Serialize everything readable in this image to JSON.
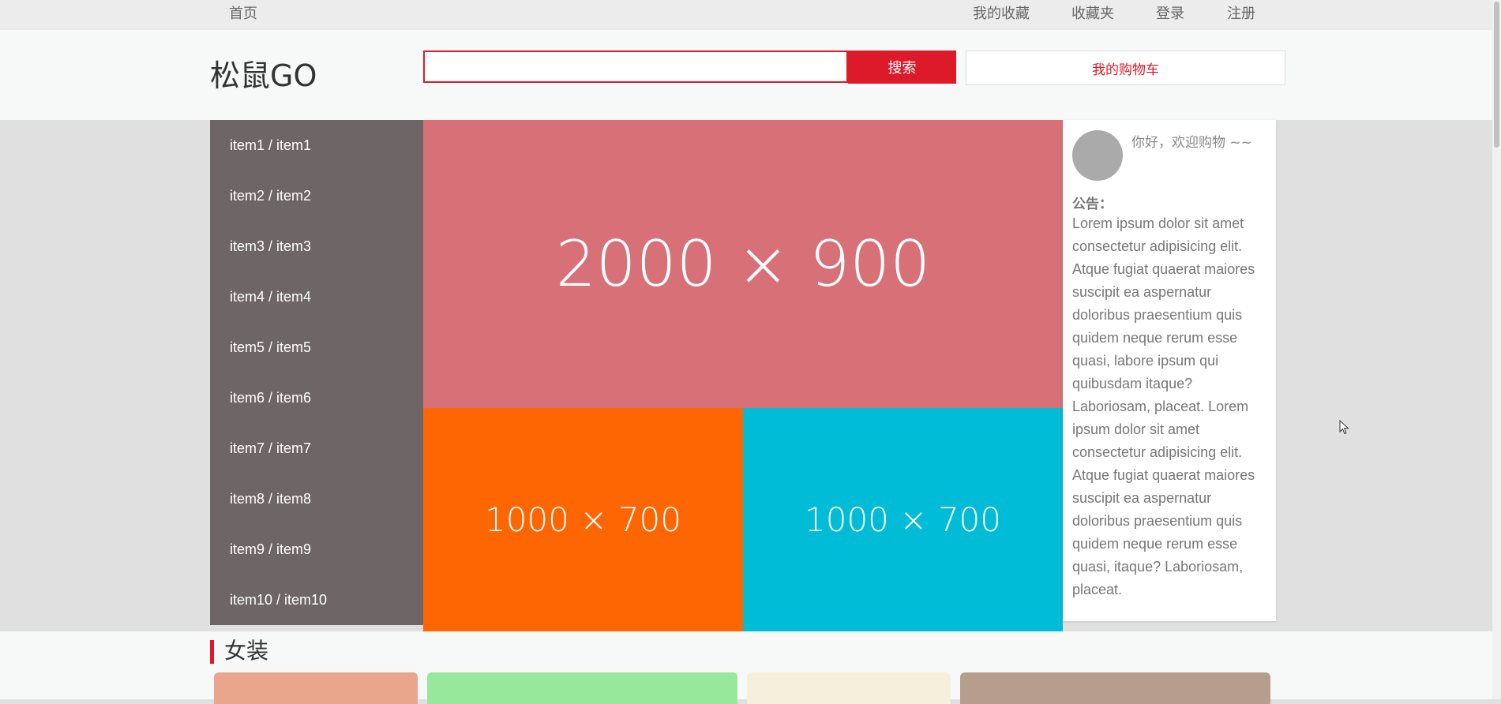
{
  "topnav": {
    "home": "首页",
    "favorites": "我的收藏",
    "bookmarks": "收藏夹",
    "login": "登录",
    "register": "注册"
  },
  "header": {
    "logo": "松鼠GO",
    "search_value": "",
    "search_button": "搜索",
    "cart_button": "我的购物车"
  },
  "sidebar": {
    "items": [
      {
        "label": "item1 / item1"
      },
      {
        "label": "item2 / item2"
      },
      {
        "label": "item3 / item3"
      },
      {
        "label": "item4 / item4"
      },
      {
        "label": "item5 / item5"
      },
      {
        "label": "item6 / item6"
      },
      {
        "label": "item7 / item7"
      },
      {
        "label": "item8 / item8"
      },
      {
        "label": "item9 / item9"
      },
      {
        "label": "item10 / item10"
      }
    ]
  },
  "banners": {
    "main": {
      "text": "2000 × 900",
      "color": "#d87078"
    },
    "left": {
      "text": "1000 × 700",
      "color": "#fe6603"
    },
    "right": {
      "text": "1000 × 700",
      "color": "#00bcd6"
    }
  },
  "notice": {
    "greeting": "你好，欢迎购物 ~~",
    "title": "公告：",
    "body": "Lorem ipsum dolor sit amet consectetur adipisicing elit. Atque fugiat quaerat maiores suscipit ea aspernatur doloribus praesentium quis quidem neque rerum esse quasi, labore ipsum qui quibusdam itaque? Laboriosam, placeat. Lorem ipsum dolor sit amet consectetur adipisicing elit. Atque fugiat quaerat maiores suscipit ea aspernatur doloribus praesentium quis quidem neque rerum esse quasi, itaque? Laboriosam, placeat."
  },
  "section": {
    "title": "女装",
    "product_colors": [
      "#eaa68d",
      "#97e89a",
      "#f5efdb",
      "#b79e8c"
    ]
  },
  "colors": {
    "accent": "#dd1a2a",
    "sidebar_bg": "#6e6566"
  }
}
